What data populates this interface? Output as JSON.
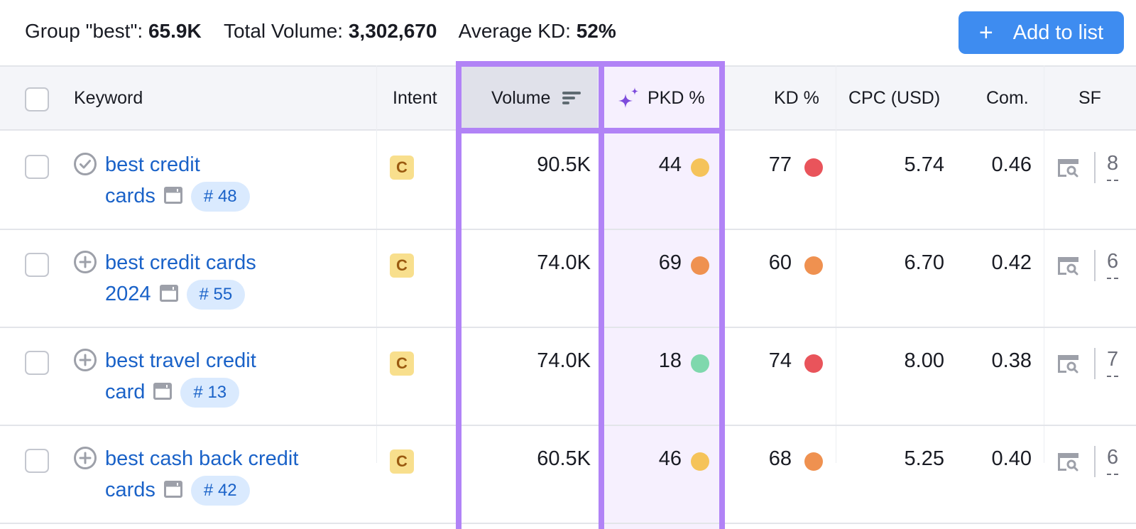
{
  "summary": {
    "group_label": "Group \"best\": ",
    "group_value": "65.9K",
    "total_volume_label": "Total Volume: ",
    "total_volume_value": "3,302,670",
    "avg_kd_label": "Average KD: ",
    "avg_kd_value": "52%"
  },
  "toolbar": {
    "add_to_list_icon": "+",
    "add_to_list_label": "Add to list"
  },
  "columns": {
    "keyword": "Keyword",
    "intent": "Intent",
    "volume": "Volume",
    "pkd": "PKD %",
    "kd": "KD %",
    "cpc": "CPC (USD)",
    "com": "Com.",
    "sf": "SF"
  },
  "colors": {
    "accent_button": "#3e8cf0",
    "highlight_border": "#b183f6",
    "link": "#1a62c8",
    "difficulty_easy": "#7fd8ad",
    "difficulty_possible": "#f5c35a",
    "difficulty_difficult": "#ef9150",
    "difficulty_hard": "#e9545b"
  },
  "rows": [
    {
      "status_icon": "check-circle-icon",
      "keyword_line1": "best credit",
      "keyword_line2": "cards",
      "position": "# 48",
      "intent": "C",
      "volume": "90.5K",
      "pkd": "44",
      "pkd_level": "possible",
      "kd": "77",
      "kd_level": "hard",
      "cpc": "5.74",
      "com": "0.46",
      "sf_count": "8"
    },
    {
      "status_icon": "plus-circle-icon",
      "keyword_line1": "best credit cards",
      "keyword_line2": "2024",
      "position": "# 55",
      "intent": "C",
      "volume": "74.0K",
      "pkd": "69",
      "pkd_level": "difficult",
      "kd": "60",
      "kd_level": "difficult",
      "cpc": "6.70",
      "com": "0.42",
      "sf_count": "6"
    },
    {
      "status_icon": "plus-circle-icon",
      "keyword_line1": "best travel credit",
      "keyword_line2": "card",
      "position": "# 13",
      "intent": "C",
      "volume": "74.0K",
      "pkd": "18",
      "pkd_level": "easy",
      "kd": "74",
      "kd_level": "hard",
      "cpc": "8.00",
      "com": "0.38",
      "sf_count": "7"
    },
    {
      "status_icon": "plus-circle-icon",
      "keyword_line1": "best cash back credit",
      "keyword_line2": "cards",
      "position": "# 42",
      "intent": "C",
      "volume": "60.5K",
      "pkd": "46",
      "pkd_level": "possible",
      "kd": "68",
      "kd_level": "difficult",
      "cpc": "5.25",
      "com": "0.40",
      "sf_count": "6"
    }
  ]
}
